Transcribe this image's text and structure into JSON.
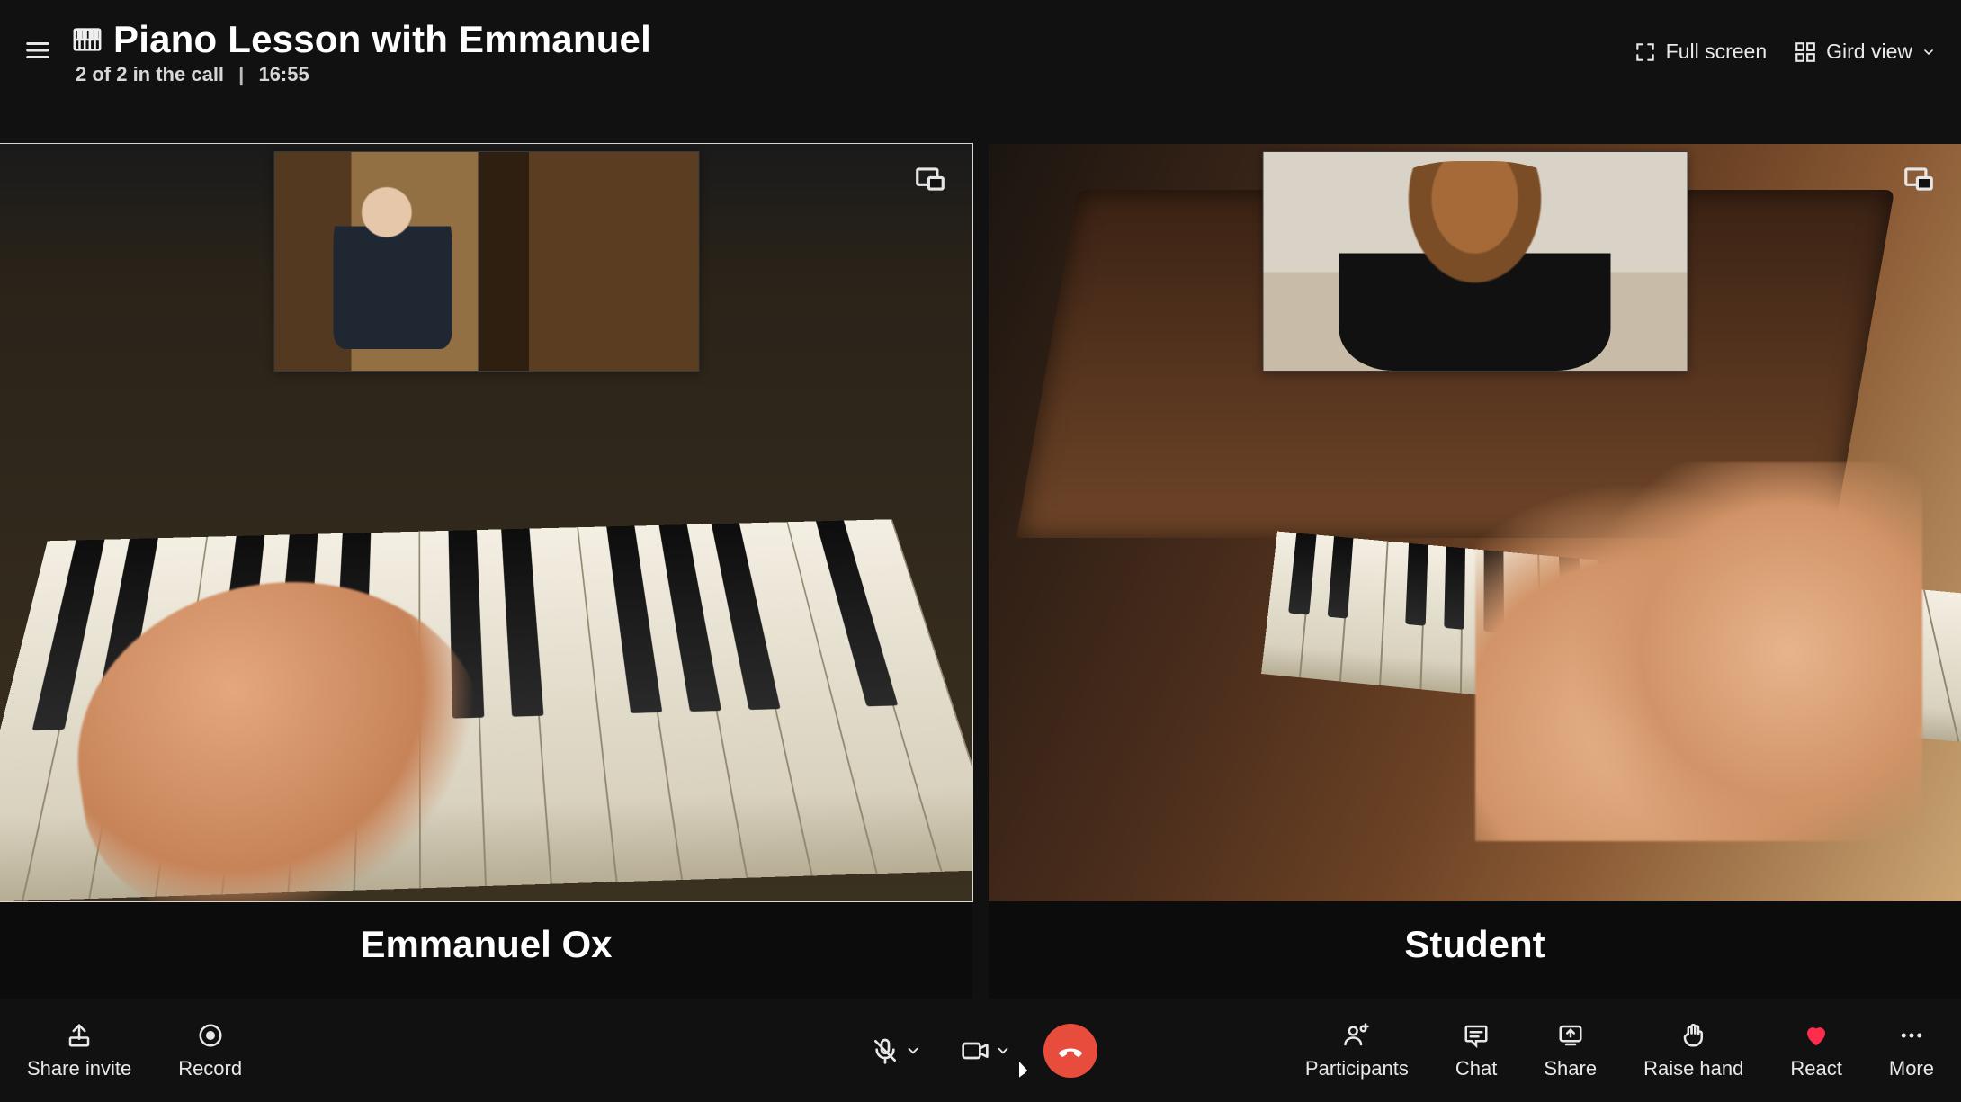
{
  "header": {
    "icon": "piano-icon",
    "title": "Piano Lesson with Emmanuel",
    "participants_status": "2 of 2 in the call",
    "call_duration": "16:55",
    "fullscreen_label": "Full screen",
    "gridview_label": "Gird view"
  },
  "tiles": [
    {
      "name": "Emmanuel Ox",
      "active": true,
      "has_pip": true,
      "has_popout": true
    },
    {
      "name": "Student",
      "active": false,
      "has_pip": true,
      "has_popout": true
    }
  ],
  "bottombar": {
    "left": [
      {
        "id": "share-invite",
        "label": "Share invite",
        "icon": "share-invite-icon"
      },
      {
        "id": "record",
        "label": "Record",
        "icon": "record-icon"
      }
    ],
    "center": {
      "mic": {
        "state": "muted",
        "icon": "mic-muted-icon"
      },
      "camera": {
        "state": "on",
        "icon": "camera-icon"
      },
      "hangup": {
        "icon": "hangup-icon",
        "color": "#e74c3c"
      }
    },
    "right": [
      {
        "id": "participants",
        "label": "Participants",
        "icon": "participants-icon"
      },
      {
        "id": "chat",
        "label": "Chat",
        "icon": "chat-icon"
      },
      {
        "id": "share",
        "label": "Share",
        "icon": "share-screen-icon"
      },
      {
        "id": "raise-hand",
        "label": "Raise hand",
        "icon": "raise-hand-icon"
      },
      {
        "id": "react",
        "label": "React",
        "icon": "heart-icon"
      },
      {
        "id": "more",
        "label": "More",
        "icon": "more-icon"
      }
    ]
  }
}
